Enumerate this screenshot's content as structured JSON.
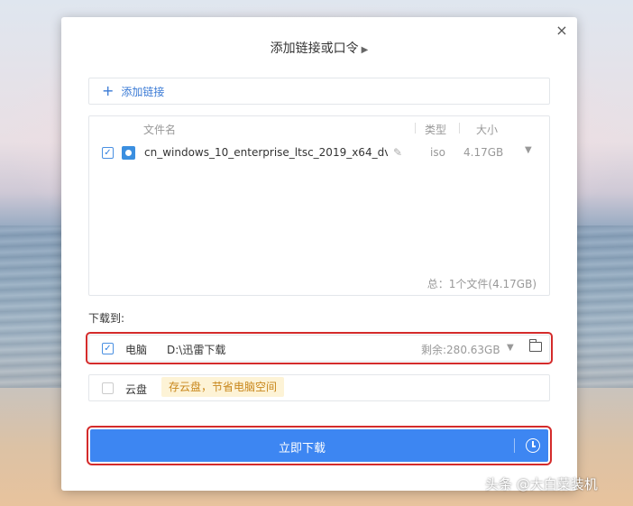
{
  "dialog": {
    "title": "添加链接或口令",
    "close_glyph": "×"
  },
  "add_link": {
    "label": "添加链接"
  },
  "file_list": {
    "headers": {
      "name": "文件名",
      "type": "类型",
      "size": "大小"
    },
    "items": [
      {
        "checked": true,
        "name": "cn_windows_10_enterprise_ltsc_2019_x64_dv...",
        "type": "iso",
        "size": "4.17GB"
      }
    ],
    "total": "总：1个文件(4.17GB)"
  },
  "download_to": {
    "label": "下载到:",
    "pc": {
      "checked": true,
      "name": "电脑",
      "path": "D:\\迅雷下载",
      "remaining": "剩余:280.63GB"
    },
    "cloud": {
      "checked": false,
      "name": "云盘",
      "tip": "存云盘，节省电脑空间"
    }
  },
  "download_button": {
    "label": "立即下载"
  },
  "watermark": "头条 @大白菜装机",
  "icons": {
    "close": "close-icon",
    "plus": "plus-icon",
    "iso": "disc-icon",
    "edit": "edit-icon",
    "folder": "folder-icon",
    "clock": "clock-icon"
  },
  "colors": {
    "accent": "#3d86f2",
    "link": "#3a7ad5",
    "highlight_box": "#d42b2b",
    "tip_bg": "#fdf3d6",
    "tip_text": "#c8861a"
  }
}
